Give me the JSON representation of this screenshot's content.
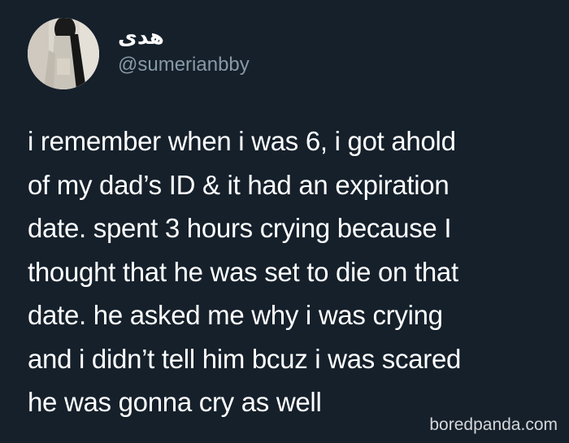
{
  "colors": {
    "background": "#15202b",
    "text_primary": "#ffffff",
    "text_secondary": "#8899a6"
  },
  "author": {
    "display_name": "هدى",
    "handle": "@sumerianbby",
    "avatar_icon": "profile-photo"
  },
  "tweet": {
    "lines": [
      "i remember when i was 6, i got ahold",
      "of my dad’s ID & it had an expiration",
      "date. spent 3 hours crying because I",
      "thought that he was set to die on that",
      "date. he asked me why i was crying",
      "and i didn’t tell him bcuz i was scared",
      "he was gonna cry as well"
    ]
  },
  "watermark": {
    "text": "boredpanda.com"
  }
}
